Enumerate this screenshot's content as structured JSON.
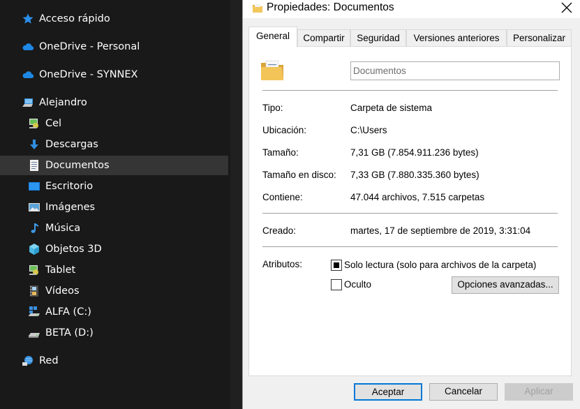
{
  "nav": {
    "items": [
      {
        "label": "Acceso rápido",
        "icon": "star-icon"
      },
      {
        "label": "OneDrive - Personal",
        "icon": "cloud-icon"
      },
      {
        "label": "OneDrive - SYNNEX",
        "icon": "cloud-icon"
      },
      {
        "label": "Alejandro",
        "icon": "computer-icon"
      },
      {
        "label": "Cel",
        "icon": "device-icon"
      },
      {
        "label": "Descargas",
        "icon": "download-arrow-icon"
      },
      {
        "label": "Documentos",
        "icon": "document-icon",
        "selected": true
      },
      {
        "label": "Escritorio",
        "icon": "desktop-icon"
      },
      {
        "label": "Imágenes",
        "icon": "pictures-icon"
      },
      {
        "label": "Música",
        "icon": "music-note-icon"
      },
      {
        "label": "Objetos 3D",
        "icon": "cube-3d-icon"
      },
      {
        "label": "Tablet",
        "icon": "device-icon"
      },
      {
        "label": "Vídeos",
        "icon": "film-icon"
      },
      {
        "label": "ALFA (C:)",
        "icon": "drive-c-icon"
      },
      {
        "label": "BETA (D:)",
        "icon": "drive-icon"
      },
      {
        "label": "Red",
        "icon": "network-icon"
      }
    ]
  },
  "dialog": {
    "title": "Propiedades: Documentos",
    "tabs": [
      "General",
      "Compartir",
      "Seguridad",
      "Versiones anteriores",
      "Personalizar"
    ],
    "active_tab": "General",
    "name_value": "Documentos",
    "props": {
      "tipo_label": "Tipo:",
      "tipo_value": "Carpeta de sistema",
      "ubicacion_label": "Ubicación:",
      "ubicacion_value": "C:\\Users",
      "tamano_label": "Tamaño:",
      "tamano_value": "7,31 GB (7.854.911.236 bytes)",
      "tamano_disco_label": "Tamaño en disco:",
      "tamano_disco_value": "7,33 GB (7.880.335.360 bytes)",
      "contiene_label": "Contiene:",
      "contiene_value": "47.044 archivos, 7.515 carpetas",
      "creado_label": "Creado:",
      "creado_value": "martes, 17 de septiembre de 2019, 3:31:04"
    },
    "attributes": {
      "label": "Atributos:",
      "readonly_label": "Solo lectura (solo para archivos de la carpeta)",
      "readonly_state": "indeterminate",
      "hidden_label": "Oculto",
      "hidden_state": "unchecked",
      "advanced_button": "Opciones avanzadas..."
    },
    "buttons": {
      "ok": "Aceptar",
      "cancel": "Cancelar",
      "apply": "Aplicar"
    }
  },
  "colors": {
    "accent": "#0078d7",
    "nav_bg": "#191919",
    "selected_bg": "#353535",
    "dialog_bg": "#f0f0f0"
  }
}
